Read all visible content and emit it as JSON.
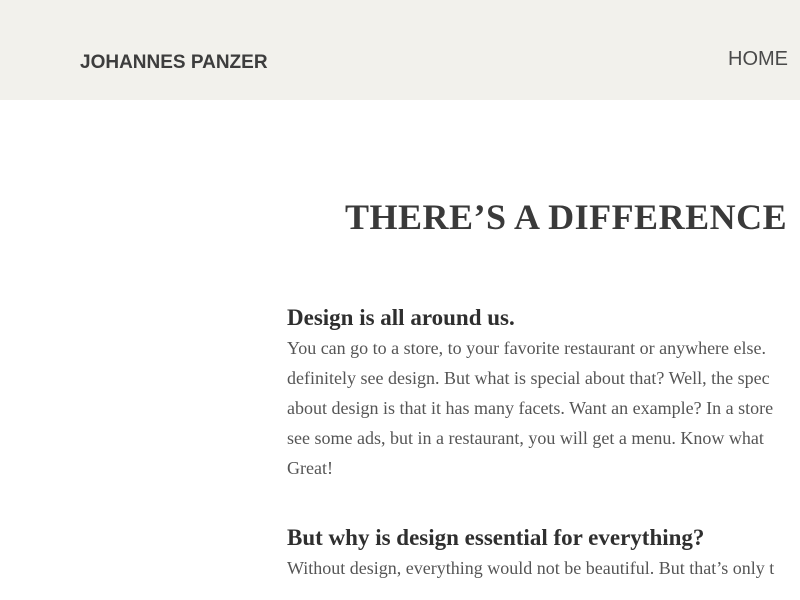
{
  "header": {
    "site_name": "JOHANNES PANZER",
    "nav": {
      "home_label": "HOME"
    }
  },
  "main": {
    "title": "THERE’S A DIFFERENCE",
    "sections": [
      {
        "heading": "Design is all around us.",
        "lines": [
          "You can go to a store, to your favorite restaurant or anywhere else.",
          "definitely see design. But what is special about that? Well, the spec",
          "about design is that it has many facets. Want an example? In a store",
          "see some ads, but in a restaurant, you will get a menu. Know what",
          "Great!"
        ]
      },
      {
        "heading": "But why is design essential for everything?",
        "lines": [
          "Without design, everything would not be beautiful. But that’s only t"
        ]
      }
    ]
  }
}
